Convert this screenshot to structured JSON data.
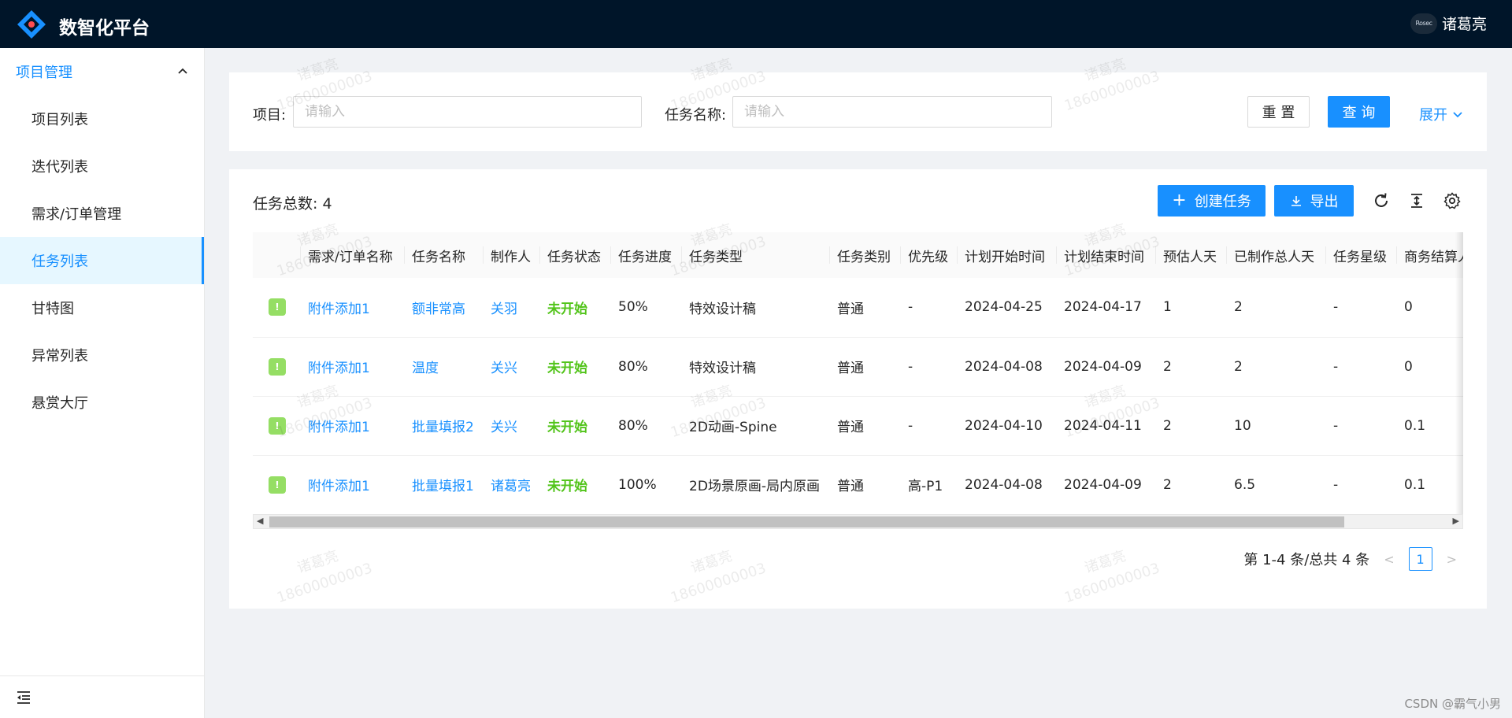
{
  "header": {
    "title": "数智化平台",
    "avatar_text": "Rosec",
    "username": "诸葛亮"
  },
  "sidebar": {
    "group": "项目管理",
    "items": [
      {
        "label": "项目列表"
      },
      {
        "label": "迭代列表"
      },
      {
        "label": "需求/订单管理"
      },
      {
        "label": "任务列表"
      },
      {
        "label": "甘特图"
      },
      {
        "label": "异常列表"
      },
      {
        "label": "悬赏大厅"
      }
    ],
    "active_index": 3
  },
  "search": {
    "project_label": "项目:",
    "project_placeholder": "请输入",
    "task_label": "任务名称:",
    "task_placeholder": "请输入",
    "reset_label": "重 置",
    "query_label": "查 询",
    "expand_label": "展开"
  },
  "table_card": {
    "total_label": "任务总数:",
    "total_value": "4",
    "create_label": "创建任务",
    "export_label": "导出",
    "columns": [
      "",
      "需求/订单名称",
      "任务名称",
      "制作人",
      "任务状态",
      "任务进度",
      "任务类型",
      "任务类别",
      "优先级",
      "计划开始时间",
      "计划结束时间",
      "预估人天",
      "已制作总人天",
      "任务星级",
      "商务结算人天"
    ],
    "rows": [
      [
        "附件添加1",
        "额非常高",
        "关羽",
        "未开始",
        "50%",
        "特效设计稿",
        "普通",
        "-",
        "2024-04-25",
        "2024-04-17",
        "1",
        "2",
        "-",
        "0"
      ],
      [
        "附件添加1",
        "温度",
        "关兴",
        "未开始",
        "80%",
        "特效设计稿",
        "普通",
        "-",
        "2024-04-08",
        "2024-04-09",
        "2",
        "2",
        "-",
        "0"
      ],
      [
        "附件添加1",
        "批量填报2",
        "关兴",
        "未开始",
        "80%",
        "2D动画-Spine",
        "普通",
        "-",
        "2024-04-10",
        "2024-04-11",
        "2",
        "10",
        "-",
        "0.1"
      ],
      [
        "附件添加1",
        "批量填报1",
        "诸葛亮",
        "未开始",
        "100%",
        "2D场景原画-局内原画",
        "普通",
        "高-P1",
        "2024-04-08",
        "2024-04-09",
        "2",
        "6.5",
        "-",
        "0.1"
      ]
    ],
    "pagination_text": "第 1-4 条/总共 4 条",
    "current_page": "1"
  },
  "watermark": {
    "name": "诸葛亮",
    "phone": "18600000003"
  },
  "footer_credit": "CSDN @霸气小男",
  "colors": {
    "header_bg": "#001529",
    "primary": "#1890ff",
    "status_green": "#52c41a",
    "row_icon": "#95de64"
  }
}
